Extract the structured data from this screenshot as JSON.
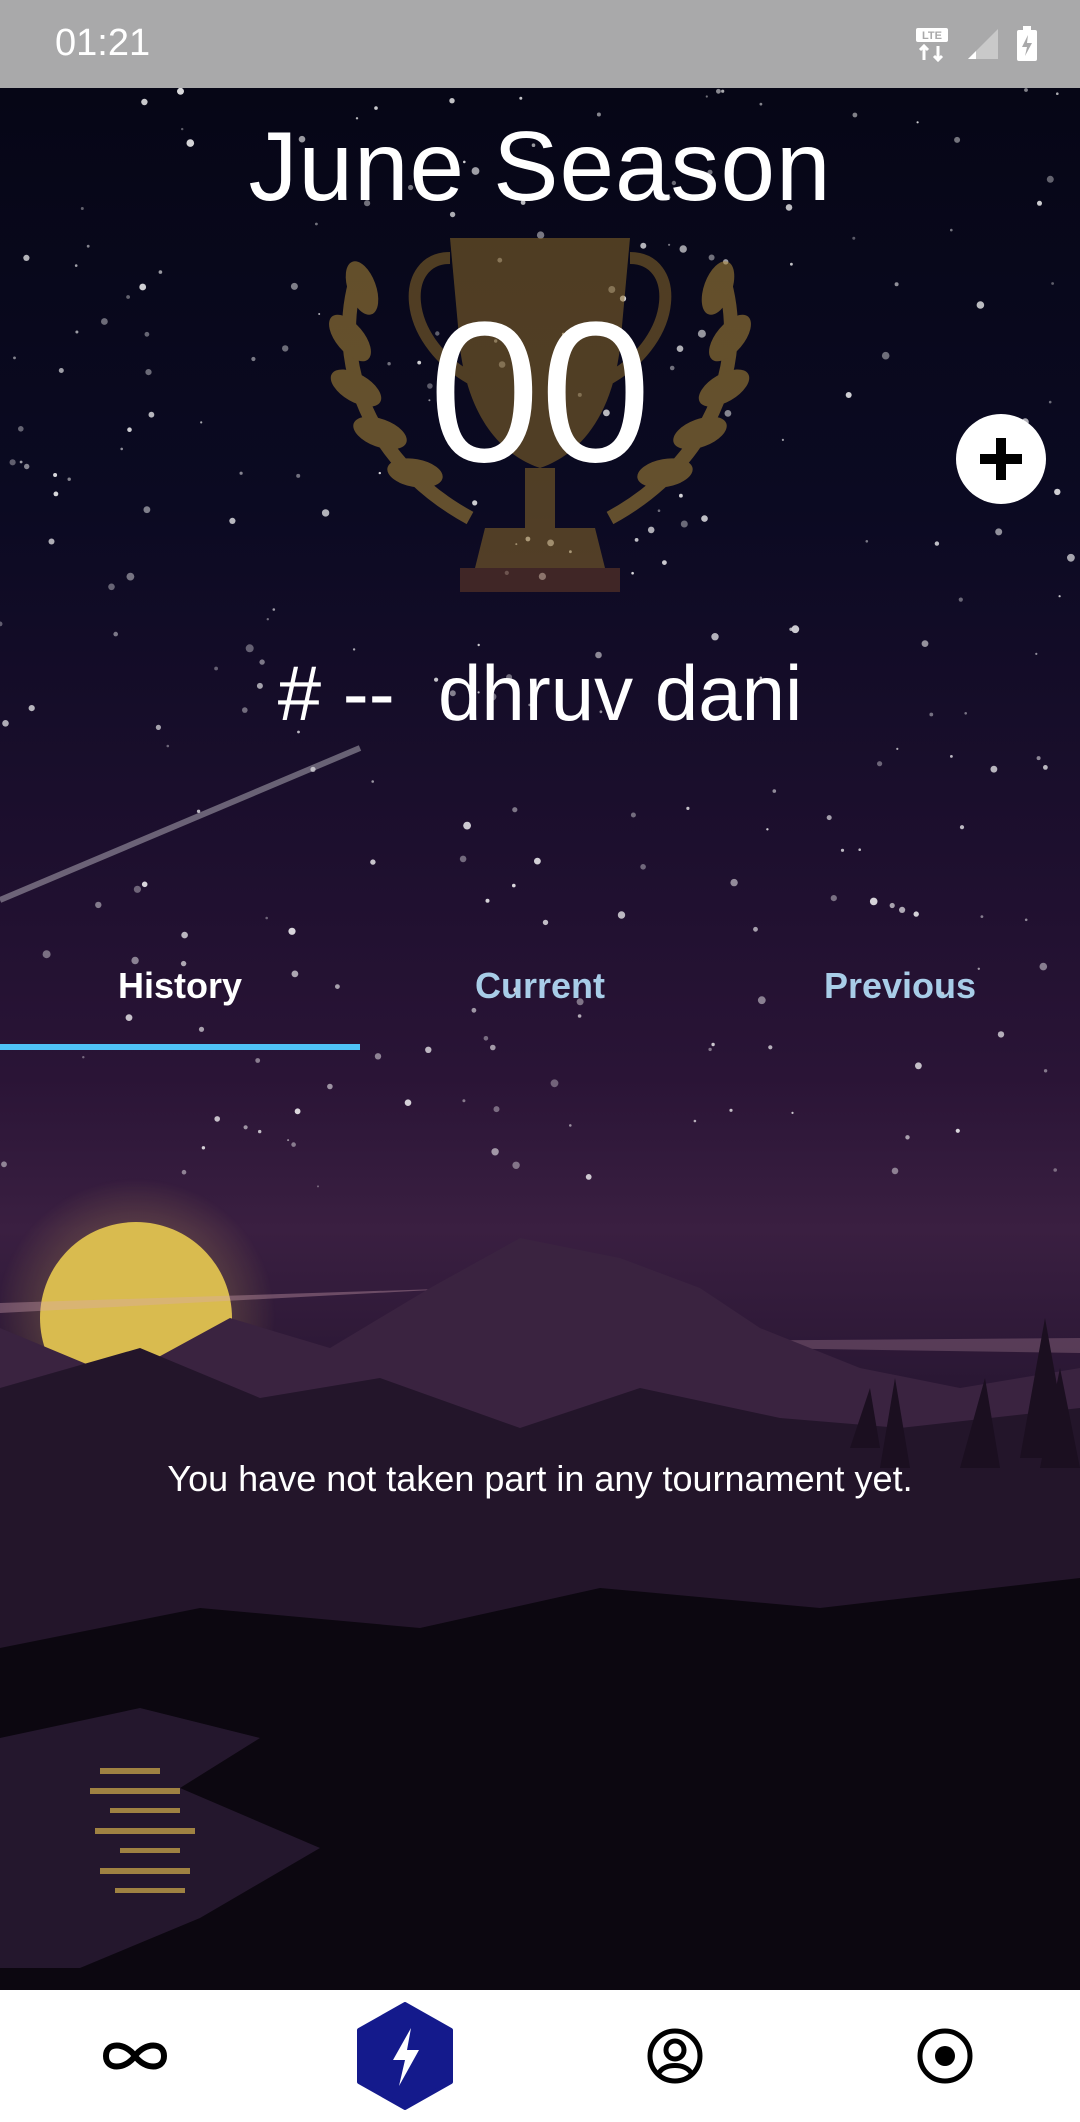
{
  "status_bar": {
    "time": "01:21",
    "icons": [
      "lte-icon",
      "signal-icon",
      "battery-charging-icon"
    ]
  },
  "header": {
    "season_title": "June Season",
    "score": "00",
    "rank_prefix": "# --",
    "username": "dhruv dani"
  },
  "tabs": [
    {
      "label": "History",
      "active": true
    },
    {
      "label": "Current",
      "active": false
    },
    {
      "label": "Previous",
      "active": false
    }
  ],
  "content": {
    "empty_message": "You have not taken part in any tournament yet."
  },
  "bottom_nav": {
    "items": [
      "infinity-icon",
      "bolt-icon",
      "profile-icon",
      "record-icon"
    ],
    "active_index": 1
  },
  "colors": {
    "accent": "#4fc3f7",
    "nav_active": "#141a8c",
    "tab_inactive": "#a8cde8",
    "status_bar": "#a9a9aa"
  }
}
